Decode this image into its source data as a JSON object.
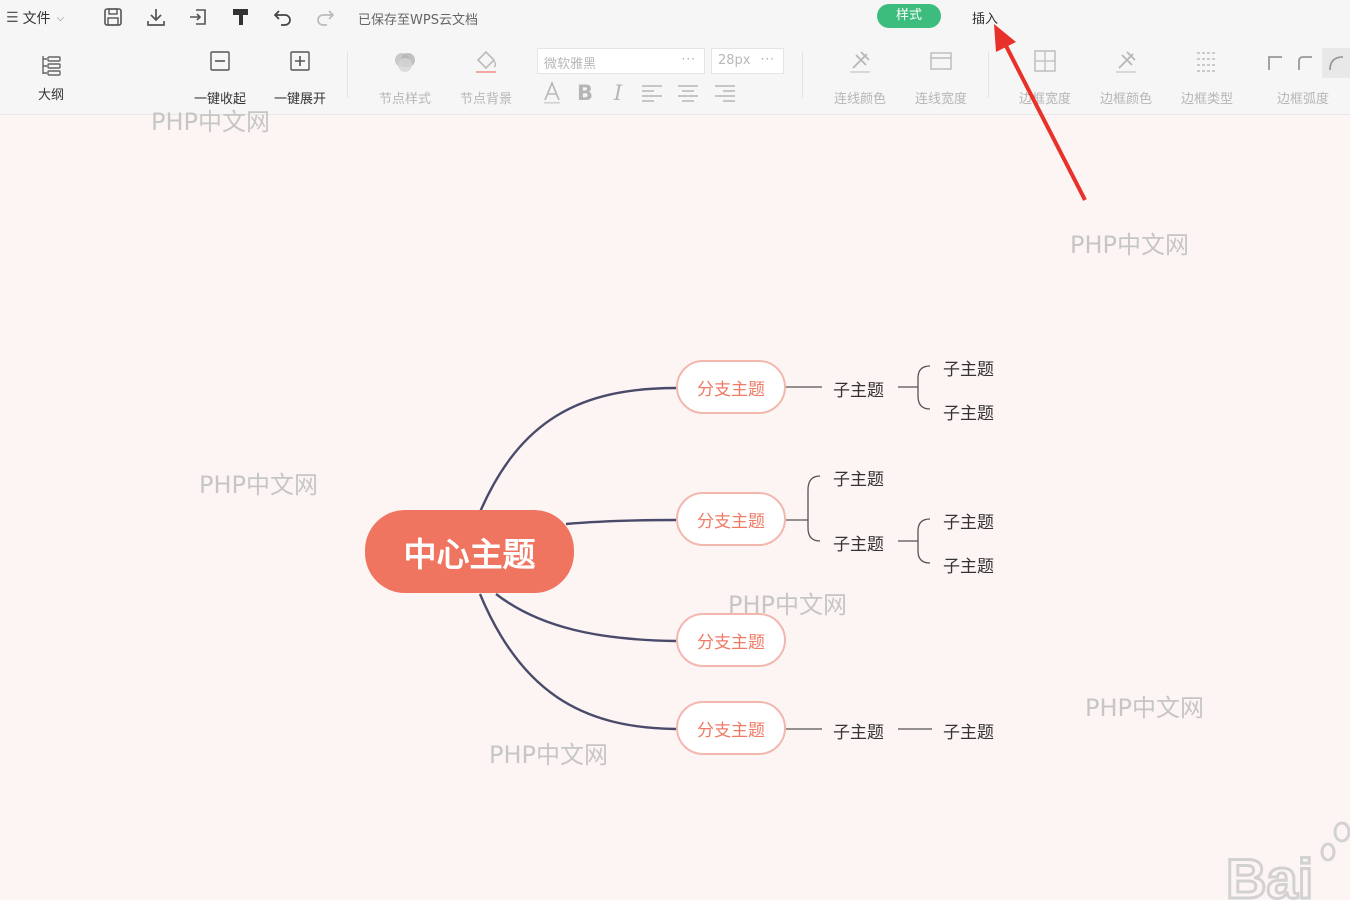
{
  "toolbar": {
    "file_label": "文件",
    "saved_status": "已保存至WPS云文档",
    "tabs": {
      "style": "样式",
      "insert": "插入"
    },
    "accent_color": "#3dbd7d"
  },
  "ribbon": {
    "outline": "大纲",
    "collapse_all": "一键收起",
    "expand_all": "一键展开",
    "node_style": "节点样式",
    "node_background": "节点背景",
    "font_family": "微软雅黑",
    "font_size": "28px",
    "line_color": "连线颜色",
    "line_width": "连线宽度",
    "border_width": "边框宽度",
    "border_color": "边框颜色",
    "border_type": "边框类型",
    "border_radius": "边框弧度"
  },
  "mindmap": {
    "central": "中心主题",
    "central_color": "#f07560",
    "branch_border_color": "#f2b7ad",
    "line_color": "#4a4a6a",
    "branches": [
      {
        "label": "分支主题",
        "children": [
          {
            "label": "子主题",
            "children": [
              "子主题",
              "子主题"
            ]
          }
        ]
      },
      {
        "label": "分支主题",
        "children": [
          {
            "label": "子主题",
            "children": []
          },
          {
            "label": "子主题",
            "children": [
              "子主题",
              "子主题"
            ]
          }
        ]
      },
      {
        "label": "分支主题",
        "children": []
      },
      {
        "label": "分支主题",
        "children": [
          {
            "label": "子主题",
            "children": [
              "子主题"
            ]
          }
        ]
      }
    ]
  },
  "watermarks": [
    "PHP中文网",
    "PHP中文网",
    "PHP中文网",
    "PHP中文网",
    "PHP中文网",
    "PHP中文网"
  ],
  "baidu_logo_text": "Bai"
}
